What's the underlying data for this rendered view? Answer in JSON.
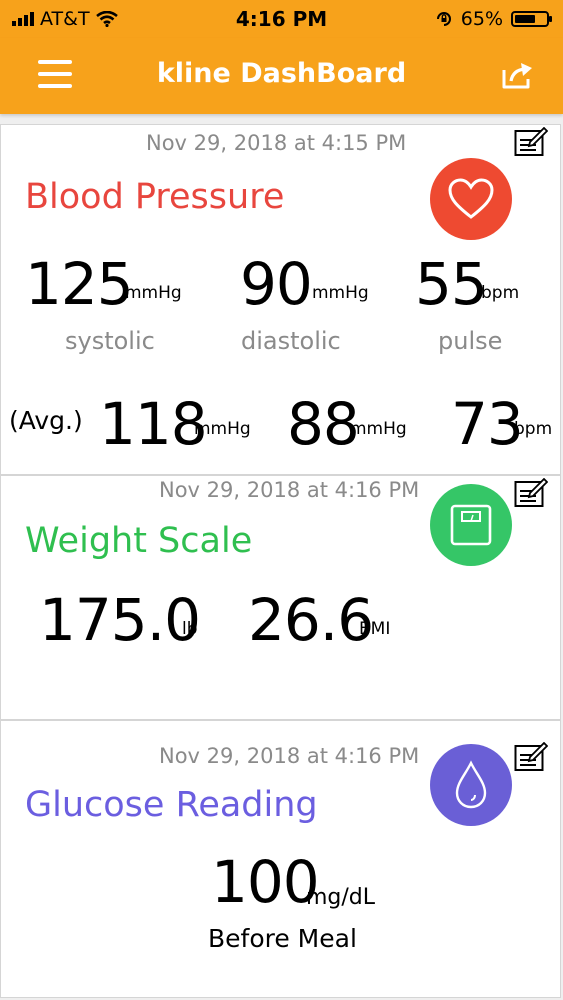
{
  "status_bar": {
    "carrier": "AT&T",
    "time": "4:16 PM",
    "battery": "65%",
    "battery_level": 0.65
  },
  "nav": {
    "title": "kline DashBoard"
  },
  "blood_pressure": {
    "timestamp": "Nov 29, 2018 at 4:15 PM",
    "title": "Blood Pressure",
    "title_color": "#e8463e",
    "icon_color": "#ee4a31",
    "systolic": "125",
    "systolic_unit": "mmHg",
    "systolic_label": "systolic",
    "diastolic": "90",
    "diastolic_unit": "mmHg",
    "diastolic_label": "diastolic",
    "pulse": "55",
    "pulse_unit": "bpm",
    "pulse_label": "pulse",
    "avg_label": "(Avg.)",
    "avg_systolic": "118",
    "avg_systolic_unit": "mmHg",
    "avg_diastolic": "88",
    "avg_diastolic_unit": "mmHg",
    "avg_pulse": "73",
    "avg_pulse_unit": "bpm"
  },
  "weight": {
    "timestamp": "Nov 29, 2018 at 4:16 PM",
    "title": "Weight Scale",
    "title_color": "#2fbf4f",
    "icon_color": "#35c667",
    "weight": "175.0",
    "weight_unit": "lb",
    "bmi": "26.6",
    "bmi_unit": "BMI"
  },
  "glucose": {
    "timestamp": "Nov 29, 2018 at 4:16 PM",
    "title": "Glucose Reading",
    "title_color": "#6b5ee0",
    "icon_color": "#6a5fd6",
    "value": "100",
    "unit": "mg/dL",
    "context": "Before Meal"
  }
}
